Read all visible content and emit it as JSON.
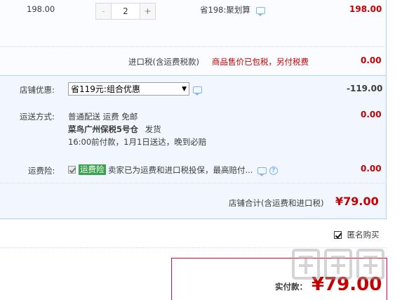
{
  "item": {
    "unit_price": "198.00",
    "quantity": "2",
    "minus": "-",
    "plus": "+",
    "promo": "省198:聚划算",
    "line_total": "198.00"
  },
  "tax": {
    "label": "进口税(含运费税款)",
    "note": "商品售价已包税，另付税费",
    "amount": "0.00"
  },
  "discount": {
    "label": "店铺优惠:",
    "selected": "省119元:组合优惠",
    "amount": "-119.00"
  },
  "shipping": {
    "label": "运送方式:",
    "method": "普通配送 运费 免邮",
    "warehouse": "菜鸟广州保税5号仓",
    "ship_action": "发货",
    "eta": "16:00前付款，1月1日送达，晚到必赔",
    "amount": "0.00"
  },
  "insurance": {
    "label": "运费险:",
    "tag": "运费险",
    "text": "卖家已为运费和进口税投保，最高赔付...",
    "amount": "0.00"
  },
  "subtotal": {
    "label": "店铺合计(含运费和进口税)",
    "amount": "¥79.00"
  },
  "anonymous": {
    "label": "匿名购买"
  },
  "payment": {
    "label": "实付款：",
    "amount": "¥79.00"
  },
  "colors": {
    "price_red": "#c40000",
    "border_blue": "#b2d1ff",
    "panel_bg": "#f2f7ff",
    "tag_green": "#3aa24a",
    "pay_border": "#ff0036"
  }
}
